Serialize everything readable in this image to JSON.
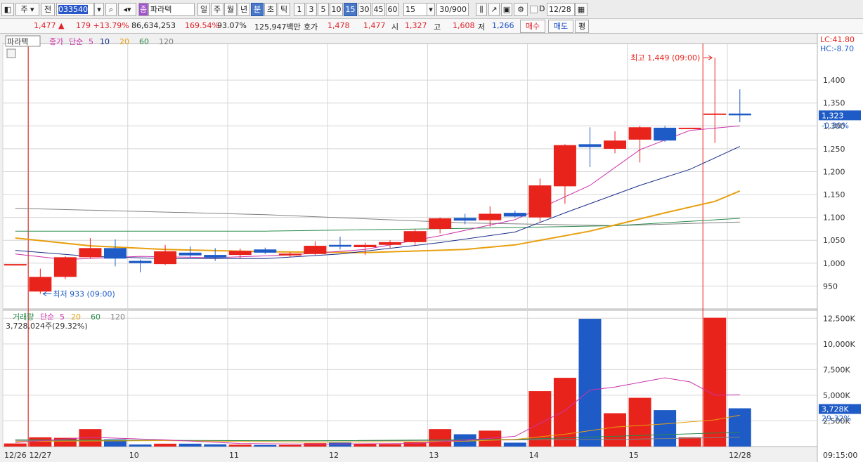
{
  "toolbar": {
    "type_label": "주",
    "prev_label": "전",
    "code": "033540",
    "name_badge": "종",
    "stock_name": "파라텍",
    "periods": [
      "일",
      "주",
      "월",
      "년",
      "분",
      "초",
      "틱"
    ],
    "intervals": [
      "1",
      "3",
      "5",
      "10",
      "15",
      "30",
      "45",
      "60"
    ],
    "interval_value": "15",
    "count": "30/900",
    "checkbox_label": "D",
    "date": "12/28"
  },
  "quote": {
    "price": "1,477",
    "change": "179",
    "change_pct": "+13.79%",
    "volume": "86,634,253",
    "volume_ratio": "169.54%",
    "turnover_ratio": "93.07%",
    "amount": "125,947백만",
    "ask_label": "호가",
    "ask1": "1,478",
    "bid1": "1,477",
    "open_label": "시",
    "open": "1,327",
    "high_label": "고",
    "high": "1,608",
    "low_label": "저",
    "low": "1,266",
    "buy_label": "매수",
    "sell_label": "매도",
    "eval_label": "평"
  },
  "colors": {
    "up": "#e8231c",
    "down": "#1e5bc6",
    "ma5": "#cc33aa",
    "ma10": "#1a2f8a",
    "ma20": "#e8a010",
    "ma60": "#2a8a4a",
    "ma120": "#808080",
    "grid": "#d6d6d6"
  },
  "chart_data": {
    "type": "candlestick",
    "title": "파라텍",
    "price_legend": [
      "종가",
      "단순",
      "5",
      "10",
      "20",
      "60",
      "120"
    ],
    "volume_legend": [
      "거래량",
      "단순",
      "5",
      "20",
      "60",
      "120"
    ],
    "volume_readout": "3,728,024주(29.32%)",
    "annotation_high": "최고 1,449 (09:00)",
    "annotation_low": "최저 933 (09:00)",
    "lc_label": "LC:41.80",
    "hc_label": "HC:-8.70",
    "current_price_label": "1,323",
    "current_change_label": "-0.30%",
    "volume_current_label": "3,728K",
    "volume_pct_label": "29.32%",
    "time_label": "09:15:00",
    "x_labels": [
      {
        "i": 0,
        "t": "12/26"
      },
      {
        "i": 1,
        "t": "12/27"
      },
      {
        "i": 5,
        "t": "10"
      },
      {
        "i": 9,
        "t": "11"
      },
      {
        "i": 13,
        "t": "12"
      },
      {
        "i": 17,
        "t": "13"
      },
      {
        "i": 21,
        "t": "14"
      },
      {
        "i": 25,
        "t": "15"
      },
      {
        "i": 29,
        "t": "12/28"
      }
    ],
    "ylim": [
      900,
      1480
    ],
    "yticks": [
      950,
      1000,
      1050,
      1100,
      1150,
      1200,
      1250,
      1300,
      1350,
      1400
    ],
    "vol_ylim": [
      0,
      13000
    ],
    "vol_ticks": [
      2500,
      5000,
      7500,
      10000,
      12500
    ],
    "vol_tick_labels": [
      "2,500K",
      "5,000K",
      "7,500K",
      "10,000K",
      "12,500K"
    ],
    "candles": [
      {
        "o": 998,
        "h": 998,
        "l": 998,
        "c": 998,
        "v": 300
      },
      {
        "o": 938,
        "h": 988,
        "l": 933,
        "c": 970,
        "v": 900
      },
      {
        "o": 970,
        "h": 1015,
        "l": 965,
        "c": 1013,
        "v": 850
      },
      {
        "o": 1013,
        "h": 1055,
        "l": 1010,
        "c": 1033,
        "v": 1700
      },
      {
        "o": 1033,
        "h": 1052,
        "l": 993,
        "c": 1010,
        "v": 700
      },
      {
        "o": 1005,
        "h": 1008,
        "l": 980,
        "c": 1000,
        "v": 200
      },
      {
        "o": 998,
        "h": 1040,
        "l": 996,
        "c": 1026,
        "v": 280
      },
      {
        "o": 1023,
        "h": 1037,
        "l": 1013,
        "c": 1017,
        "v": 280
      },
      {
        "o": 1018,
        "h": 1033,
        "l": 1005,
        "c": 1012,
        "v": 220
      },
      {
        "o": 1018,
        "h": 1032,
        "l": 1010,
        "c": 1027,
        "v": 180
      },
      {
        "o": 1030,
        "h": 1034,
        "l": 1020,
        "c": 1023,
        "v": 150
      },
      {
        "o": 1017,
        "h": 1024,
        "l": 1013,
        "c": 1021,
        "v": 160
      },
      {
        "o": 1020,
        "h": 1048,
        "l": 1018,
        "c": 1038,
        "v": 330
      },
      {
        "o": 1040,
        "h": 1058,
        "l": 1030,
        "c": 1036,
        "v": 380
      },
      {
        "o": 1035,
        "h": 1045,
        "l": 1018,
        "c": 1040,
        "v": 250
      },
      {
        "o": 1040,
        "h": 1050,
        "l": 1032,
        "c": 1046,
        "v": 230
      },
      {
        "o": 1046,
        "h": 1075,
        "l": 1040,
        "c": 1070,
        "v": 420
      },
      {
        "o": 1075,
        "h": 1100,
        "l": 1065,
        "c": 1098,
        "v": 1700
      },
      {
        "o": 1099,
        "h": 1108,
        "l": 1085,
        "c": 1093,
        "v": 1200
      },
      {
        "o": 1094,
        "h": 1124,
        "l": 1080,
        "c": 1108,
        "v": 1550
      },
      {
        "o": 1110,
        "h": 1115,
        "l": 1100,
        "c": 1102,
        "v": 380
      },
      {
        "o": 1100,
        "h": 1185,
        "l": 1090,
        "c": 1170,
        "v": 5400
      },
      {
        "o": 1168,
        "h": 1260,
        "l": 1130,
        "c": 1258,
        "v": 6700
      },
      {
        "o": 1260,
        "h": 1297,
        "l": 1210,
        "c": 1254,
        "v": 12450
      },
      {
        "o": 1250,
        "h": 1288,
        "l": 1240,
        "c": 1268,
        "v": 3250
      },
      {
        "o": 1270,
        "h": 1300,
        "l": 1220,
        "c": 1297,
        "v": 4750
      },
      {
        "o": 1296,
        "h": 1300,
        "l": 1265,
        "c": 1268,
        "v": 3550
      },
      {
        "o": 1295,
        "h": 1296,
        "l": 1295,
        "c": 1296,
        "v": 900
      },
      {
        "o": 1326,
        "h": 1449,
        "l": 1263,
        "c": 1327,
        "v": 12550
      },
      {
        "o": 1327,
        "h": 1380,
        "l": 1308,
        "c": 1323,
        "v": 3728
      }
    ],
    "ma5": [
      {
        "i": 0,
        "v": 1020
      },
      {
        "i": 2,
        "v": 1008
      },
      {
        "i": 5,
        "v": 1015
      },
      {
        "i": 8,
        "v": 1012
      },
      {
        "i": 11,
        "v": 1018
      },
      {
        "i": 14,
        "v": 1030
      },
      {
        "i": 17,
        "v": 1060
      },
      {
        "i": 20,
        "v": 1095
      },
      {
        "i": 23,
        "v": 1170
      },
      {
        "i": 25,
        "v": 1248
      },
      {
        "i": 27,
        "v": 1290
      },
      {
        "i": 29,
        "v": 1300
      }
    ],
    "ma10": [
      {
        "i": 0,
        "v": 1028
      },
      {
        "i": 3,
        "v": 1015
      },
      {
        "i": 6,
        "v": 1010
      },
      {
        "i": 10,
        "v": 1010
      },
      {
        "i": 13,
        "v": 1020
      },
      {
        "i": 17,
        "v": 1045
      },
      {
        "i": 20,
        "v": 1068
      },
      {
        "i": 22,
        "v": 1110
      },
      {
        "i": 25,
        "v": 1170
      },
      {
        "i": 27,
        "v": 1205
      },
      {
        "i": 29,
        "v": 1255
      }
    ],
    "ma20": [
      {
        "i": 0,
        "v": 1055
      },
      {
        "i": 3,
        "v": 1038
      },
      {
        "i": 6,
        "v": 1030
      },
      {
        "i": 10,
        "v": 1025
      },
      {
        "i": 14,
        "v": 1023
      },
      {
        "i": 18,
        "v": 1030
      },
      {
        "i": 20,
        "v": 1040
      },
      {
        "i": 23,
        "v": 1070
      },
      {
        "i": 26,
        "v": 1110
      },
      {
        "i": 28,
        "v": 1135
      },
      {
        "i": 29,
        "v": 1158
      }
    ],
    "ma60": [
      {
        "i": 0,
        "v": 1070
      },
      {
        "i": 10,
        "v": 1070
      },
      {
        "i": 18,
        "v": 1076
      },
      {
        "i": 24,
        "v": 1082
      },
      {
        "i": 29,
        "v": 1098
      }
    ],
    "ma120": [
      {
        "i": 0,
        "v": 1120
      },
      {
        "i": 10,
        "v": 1106
      },
      {
        "i": 18,
        "v": 1088
      },
      {
        "i": 24,
        "v": 1082
      },
      {
        "i": 29,
        "v": 1090
      }
    ],
    "vol_ma5": [
      {
        "i": 0,
        "v": 400
      },
      {
        "i": 3,
        "v": 900
      },
      {
        "i": 6,
        "v": 650
      },
      {
        "i": 9,
        "v": 300
      },
      {
        "i": 12,
        "v": 230
      },
      {
        "i": 16,
        "v": 300
      },
      {
        "i": 19,
        "v": 800
      },
      {
        "i": 20,
        "v": 1000
      },
      {
        "i": 22,
        "v": 3500
      },
      {
        "i": 23,
        "v": 5500
      },
      {
        "i": 24,
        "v": 5800
      },
      {
        "i": 26,
        "v": 6700
      },
      {
        "i": 27,
        "v": 6300
      },
      {
        "i": 28,
        "v": 5000
      },
      {
        "i": 29,
        "v": 5050
      }
    ],
    "vol_ma20": [
      {
        "i": 0,
        "v": 500
      },
      {
        "i": 6,
        "v": 580
      },
      {
        "i": 12,
        "v": 420
      },
      {
        "i": 18,
        "v": 520
      },
      {
        "i": 20,
        "v": 700
      },
      {
        "i": 22,
        "v": 1200
      },
      {
        "i": 24,
        "v": 1900
      },
      {
        "i": 26,
        "v": 2200
      },
      {
        "i": 28,
        "v": 2600
      },
      {
        "i": 29,
        "v": 3050
      }
    ],
    "vol_ma60": [
      {
        "i": 0,
        "v": 650
      },
      {
        "i": 12,
        "v": 560
      },
      {
        "i": 20,
        "v": 700
      },
      {
        "i": 24,
        "v": 1000
      },
      {
        "i": 29,
        "v": 1400
      }
    ],
    "vol_ma120": [
      {
        "i": 0,
        "v": 600
      },
      {
        "i": 14,
        "v": 560
      },
      {
        "i": 24,
        "v": 700
      },
      {
        "i": 29,
        "v": 900
      }
    ]
  }
}
